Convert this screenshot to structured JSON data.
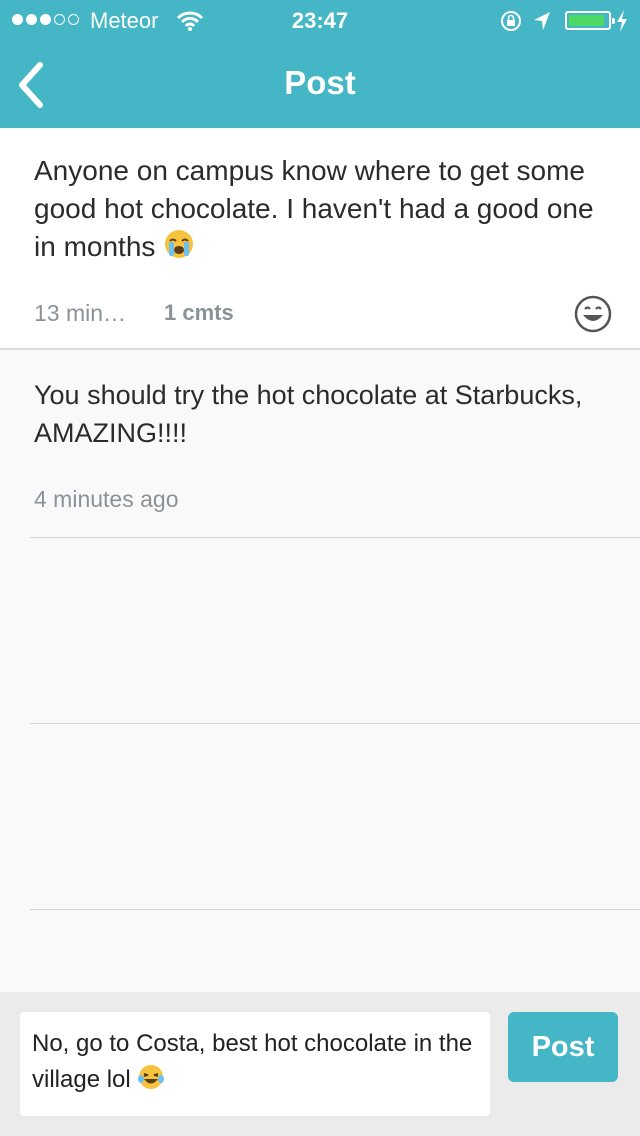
{
  "status_bar": {
    "carrier": "Meteor",
    "time": "23:47",
    "battery_level": 0.92,
    "colors": {
      "battery": "#4cd964"
    },
    "icons": [
      "wifi-icon",
      "rotation-lock-icon",
      "location-icon",
      "battery-icon",
      "charging-bolt-icon"
    ]
  },
  "header": {
    "title": "Post",
    "back_icon": "chevron-left-icon",
    "colors": {
      "background": "#44b6c6",
      "text": "#ffffff"
    }
  },
  "post": {
    "text": "Anyone on campus know where to get some good hot chocolate. I haven't had a good one in months",
    "emoji": "crying-face-emoji",
    "time": "13 min…",
    "comments": "1 cmts",
    "react_icon": "smiley-face-icon"
  },
  "comments": [
    {
      "text": "You should try the hot chocolate at Starbucks, AMAZING!!!!",
      "time": "4 minutes ago"
    }
  ],
  "composer": {
    "input_value": "No, go to Costa, best hot chocolate in the village lol",
    "input_emoji": "tears-of-joy-emoji",
    "post_label": "Post",
    "colors": {
      "button": "#44b6c6"
    }
  }
}
